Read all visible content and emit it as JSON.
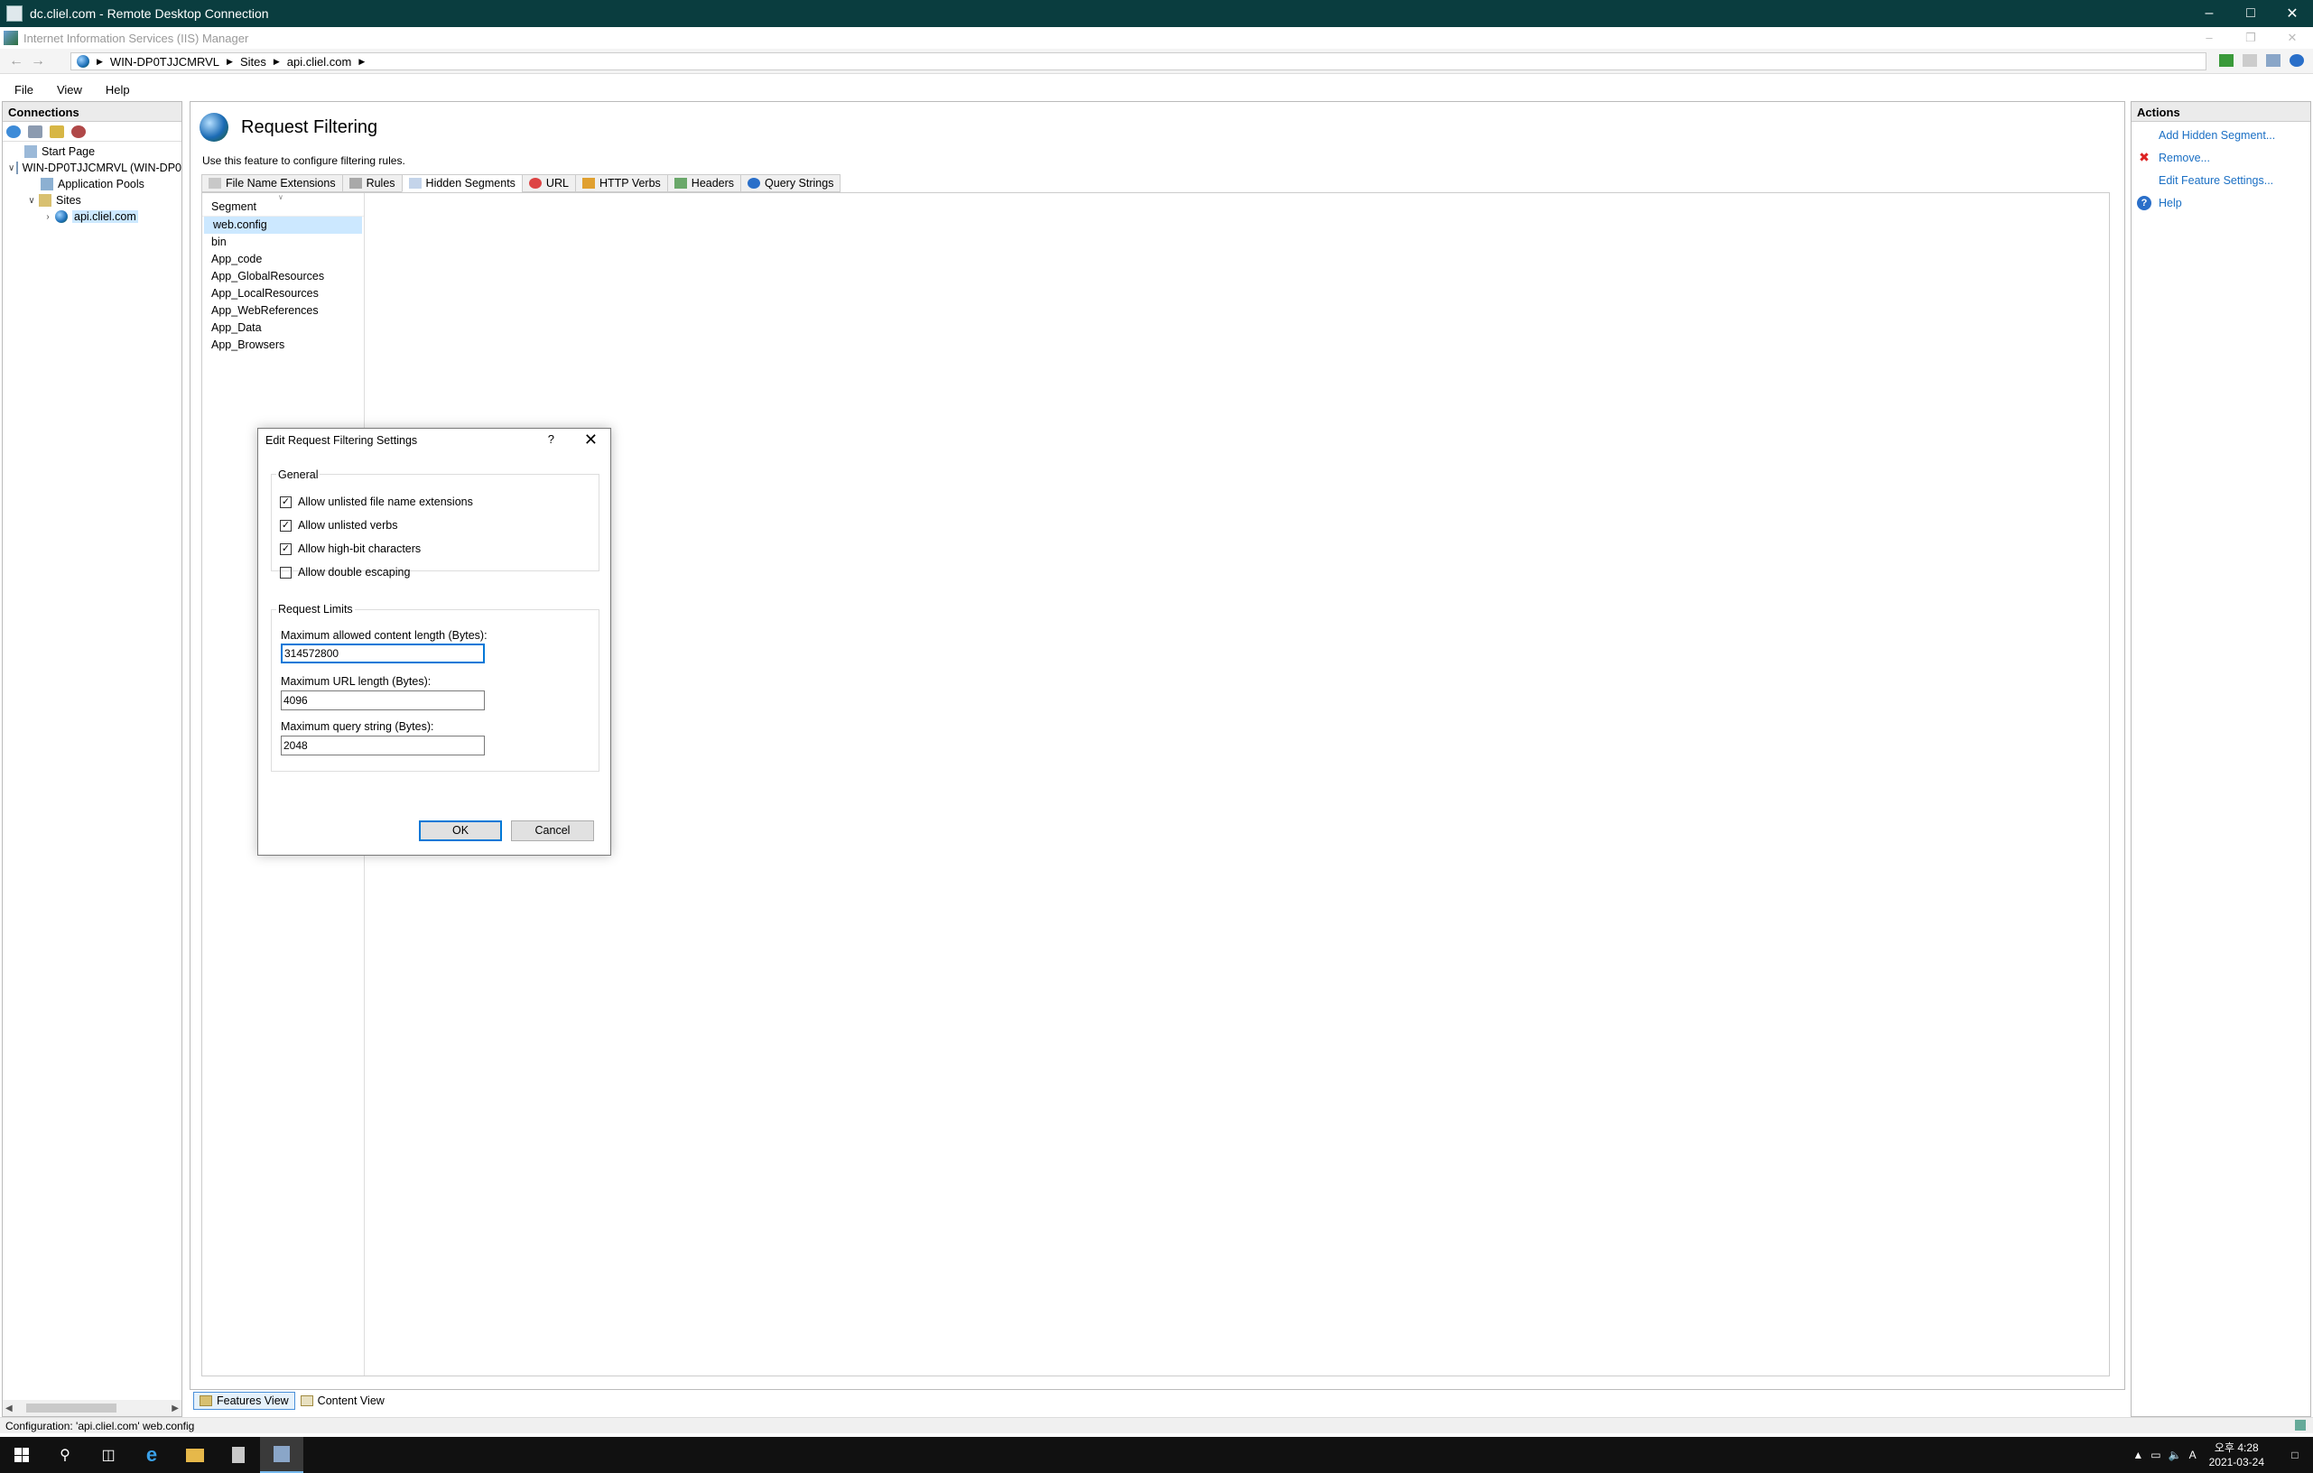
{
  "rdp": {
    "title": "dc.cliel.com - Remote Desktop Connection"
  },
  "iis": {
    "title": "Internet Information Services (IIS) Manager"
  },
  "address": {
    "crumbs": [
      "WIN-DP0TJJCMRVL",
      "Sites",
      "api.cliel.com"
    ]
  },
  "menu": {
    "file": "File",
    "view": "View",
    "help": "Help"
  },
  "connections": {
    "header": "Connections",
    "tree": {
      "start_page": "Start Page",
      "server": "WIN-DP0TJJCMRVL (WIN-DP0",
      "app_pools": "Application Pools",
      "sites": "Sites",
      "site": "api.cliel.com"
    }
  },
  "main": {
    "title": "Request Filtering",
    "description": "Use this feature to configure filtering rules.",
    "tabs": [
      "File Name Extensions",
      "Rules",
      "Hidden Segments",
      "URL",
      "HTTP Verbs",
      "Headers",
      "Query Strings"
    ],
    "active_tab": "Hidden Segments",
    "segment_header": "Segment",
    "segments": [
      "web.config",
      "bin",
      "App_code",
      "App_GlobalResources",
      "App_LocalResources",
      "App_WebReferences",
      "App_Data",
      "App_Browsers"
    ],
    "selected_segment": "web.config"
  },
  "views": {
    "features": "Features View",
    "content": "Content View"
  },
  "status": {
    "text": "Configuration: 'api.cliel.com' web.config"
  },
  "actions": {
    "header": "Actions",
    "add": "Add Hidden Segment...",
    "remove": "Remove...",
    "edit_settings": "Edit Feature Settings...",
    "help": "Help"
  },
  "dialog": {
    "title": "Edit Request Filtering Settings",
    "help_glyph": "?",
    "general_label": "General",
    "checkboxes": [
      {
        "label": "Allow unlisted file name extensions",
        "checked": true
      },
      {
        "label": "Allow unlisted verbs",
        "checked": true
      },
      {
        "label": "Allow high-bit characters",
        "checked": true
      },
      {
        "label": "Allow double escaping",
        "checked": false
      }
    ],
    "limits_label": "Request Limits",
    "max_content_label": "Maximum allowed content length (Bytes):",
    "max_content_value": "314572800",
    "max_url_label": "Maximum URL length (Bytes):",
    "max_url_value": "4096",
    "max_query_label": "Maximum query string (Bytes):",
    "max_query_value": "2048",
    "ok": "OK",
    "cancel": "Cancel"
  },
  "taskbar": {
    "ampm": "오후 4:28",
    "date": "2021-03-24",
    "ime": "A"
  },
  "colors": {
    "rdp_titlebar": "#0a3d3f",
    "selection": "#cce8ff",
    "link": "#1a6fc4",
    "focus": "#0078d7"
  }
}
